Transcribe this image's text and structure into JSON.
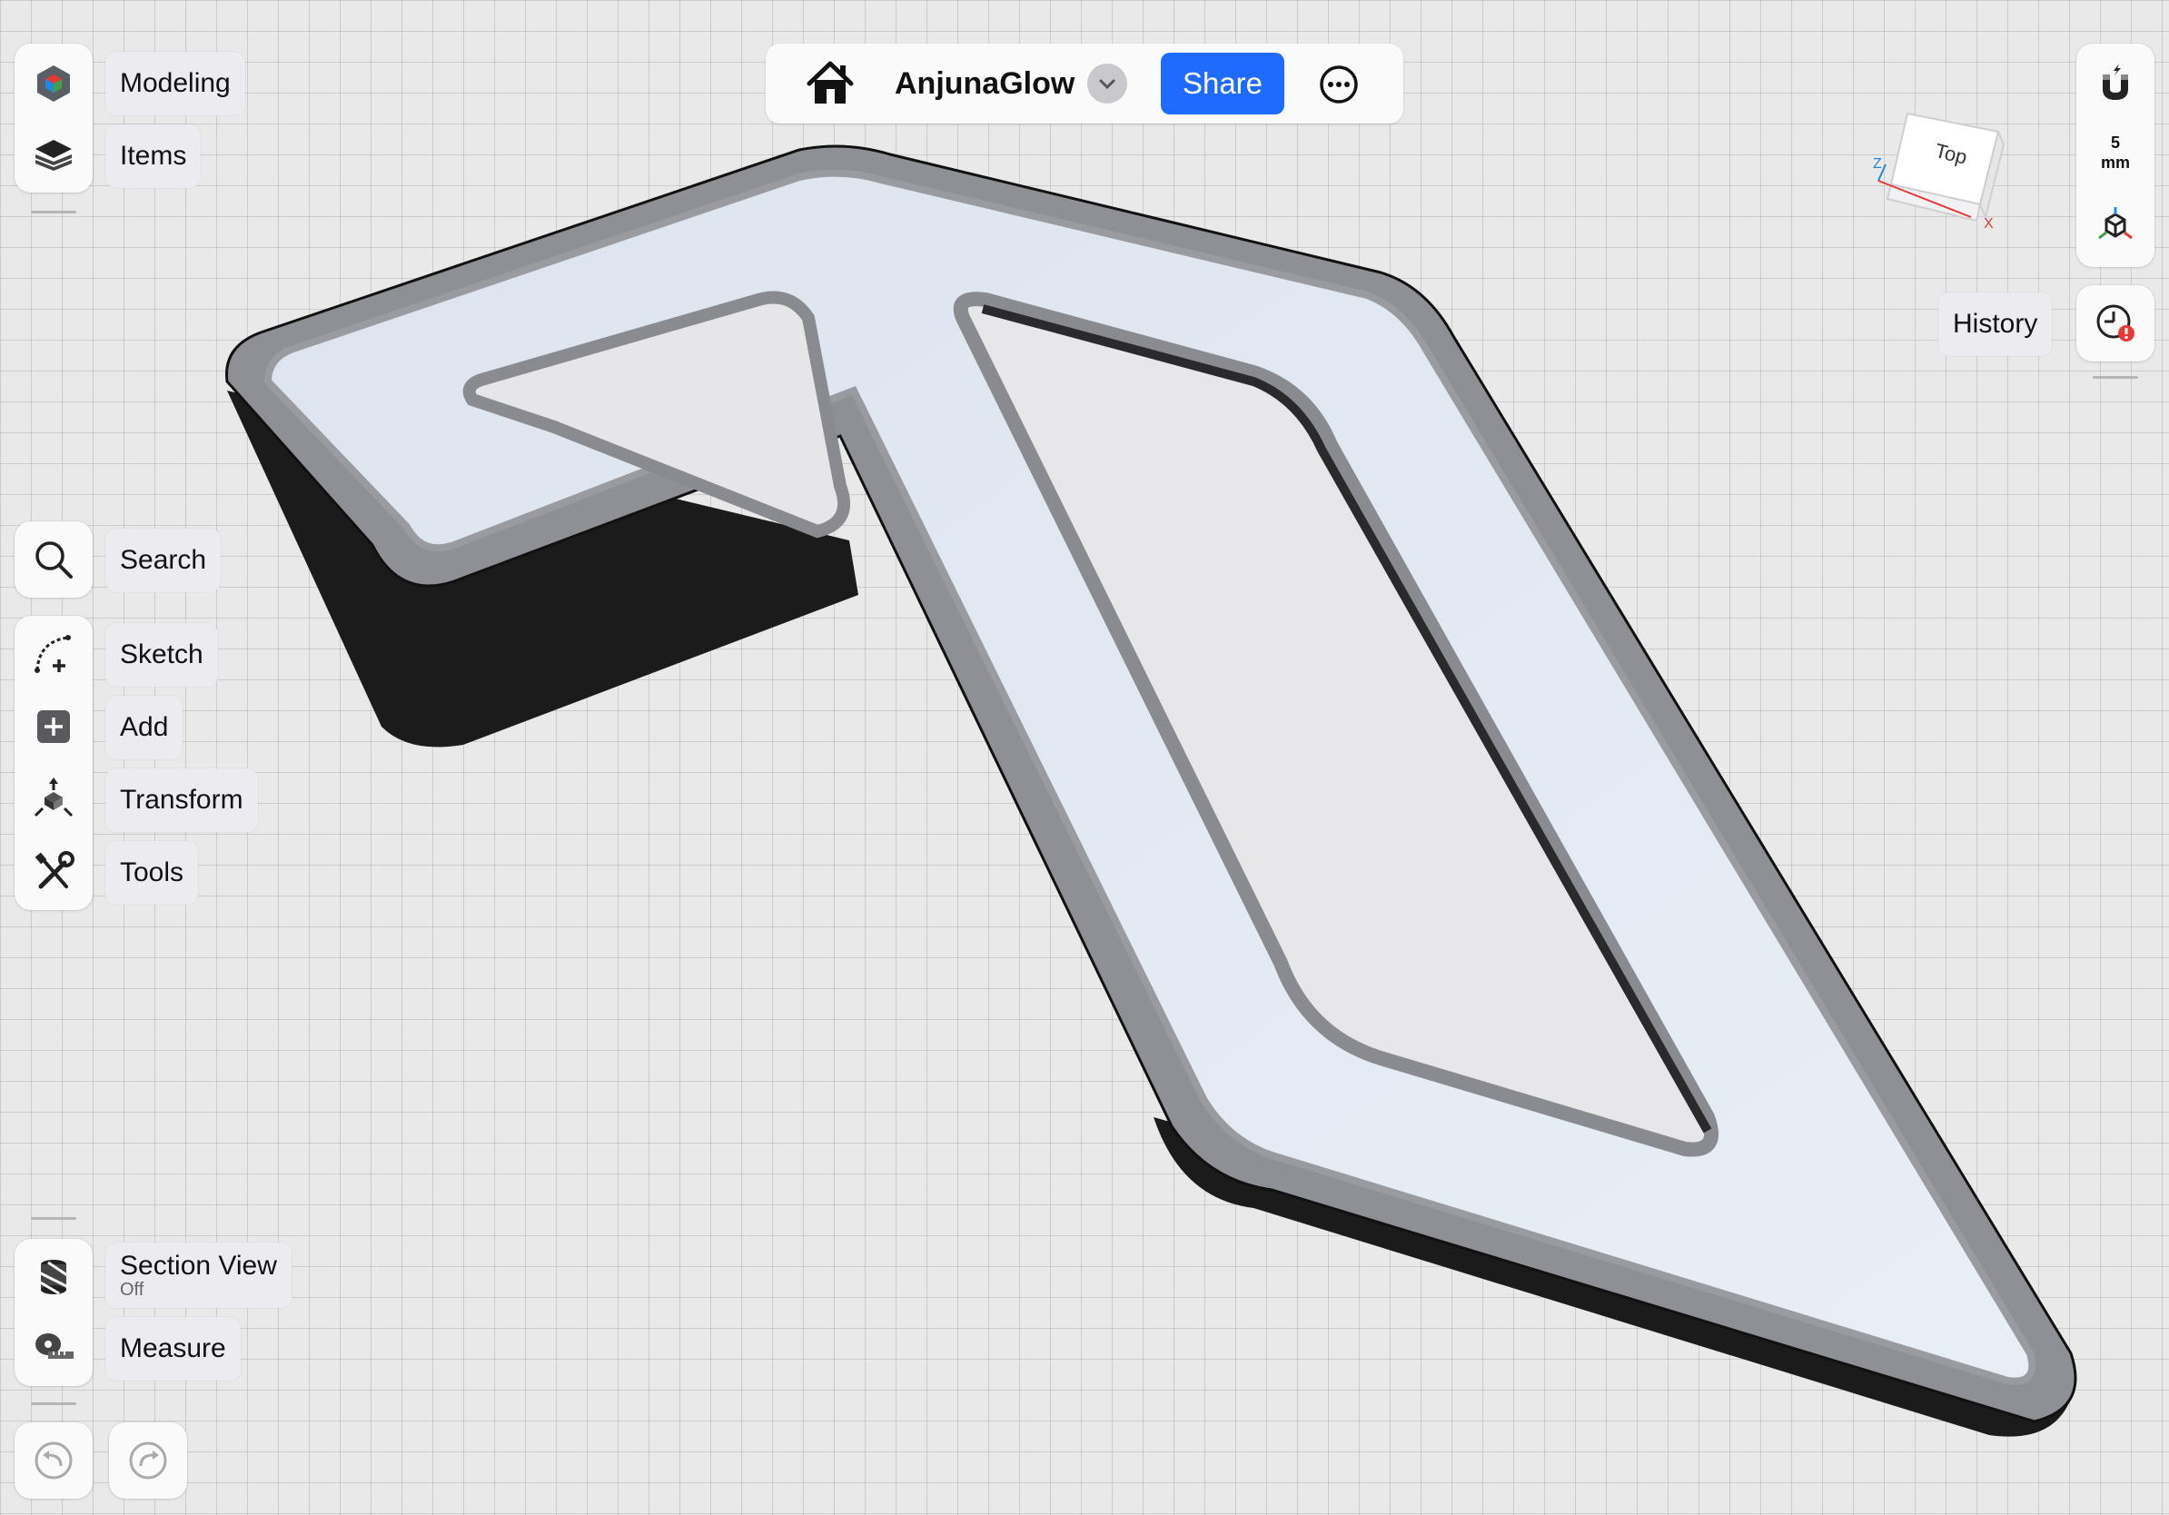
{
  "app": {
    "document_title": "AnjunaGlow",
    "share_label": "Share"
  },
  "left_top": {
    "items": [
      {
        "label": "Modeling",
        "icon": "modeling-cube-icon"
      },
      {
        "label": "Items",
        "icon": "layers-icon"
      }
    ]
  },
  "left_tools": {
    "search_label": "Search",
    "items": [
      {
        "label": "Sketch",
        "icon": "sketch-arc-icon"
      },
      {
        "label": "Add",
        "icon": "add-plus-icon"
      },
      {
        "label": "Transform",
        "icon": "transform-icon"
      },
      {
        "label": "Tools",
        "icon": "wrench-screwdriver-icon"
      }
    ]
  },
  "left_bottom": {
    "section_view_label": "Section View",
    "section_view_state": "Off",
    "measure_label": "Measure"
  },
  "right_panel": {
    "snap_value": "5",
    "snap_unit": "mm",
    "view_cube_face": "Top",
    "axis_x": "X",
    "axis_z": "Z",
    "history_label": "History"
  },
  "colors": {
    "accent": "#1f6bff",
    "warning": "#e53935",
    "canvas": "#e9e9ea"
  }
}
